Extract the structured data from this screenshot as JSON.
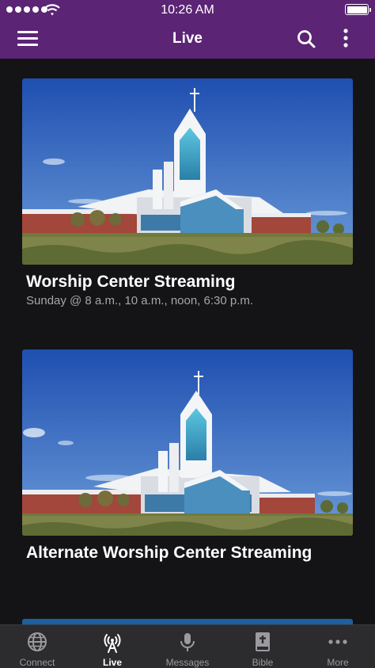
{
  "status_bar": {
    "time": "10:26 AM"
  },
  "nav": {
    "title": "Live"
  },
  "items": [
    {
      "title": "Worship Center Streaming",
      "subtitle": "Sunday @ 8 a.m., 10 a.m., noon, 6:30 p.m."
    },
    {
      "title": "Alternate Worship Center Streaming"
    }
  ],
  "tabs": [
    {
      "label": "Connect",
      "icon": "globe-icon"
    },
    {
      "label": "Live",
      "icon": "broadcast-tower-icon"
    },
    {
      "label": "Messages",
      "icon": "microphone-icon"
    },
    {
      "label": "Bible",
      "icon": "bible-icon"
    },
    {
      "label": "More",
      "icon": "more-dots-icon"
    }
  ],
  "colors": {
    "header": "#5b2475",
    "background": "#141416",
    "tabbar": "#2c2c2e",
    "subtitle": "#a6a6aa"
  }
}
